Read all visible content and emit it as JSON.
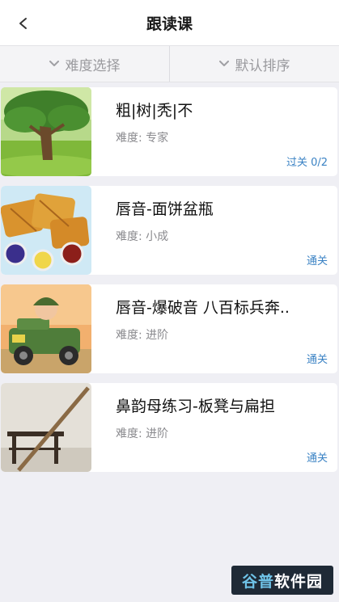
{
  "header": {
    "title": "跟读课",
    "back_icon": "chevron-left-icon"
  },
  "filters": [
    {
      "label": "难度选择",
      "icon": "chevron-down-icon"
    },
    {
      "label": "默认排序",
      "icon": "chevron-down-icon"
    }
  ],
  "lessons": [
    {
      "title": "粗|树|秃|不",
      "difficulty": "难度: 专家",
      "status": "过关 0/2"
    },
    {
      "title": "唇音-面饼盆瓶",
      "difficulty": "难度: 小成",
      "status": "通关"
    },
    {
      "title": "唇音-爆破音 八百标兵奔..",
      "difficulty": "难度: 进阶",
      "status": "通关"
    },
    {
      "title": "鼻韵母练习-板凳与扁担",
      "difficulty": "难度: 进阶",
      "status": "通关"
    }
  ],
  "watermark": {
    "part1": "谷普",
    "part2": "软件园"
  },
  "colors": {
    "accent": "#3a82c4",
    "background": "#efeff4"
  }
}
